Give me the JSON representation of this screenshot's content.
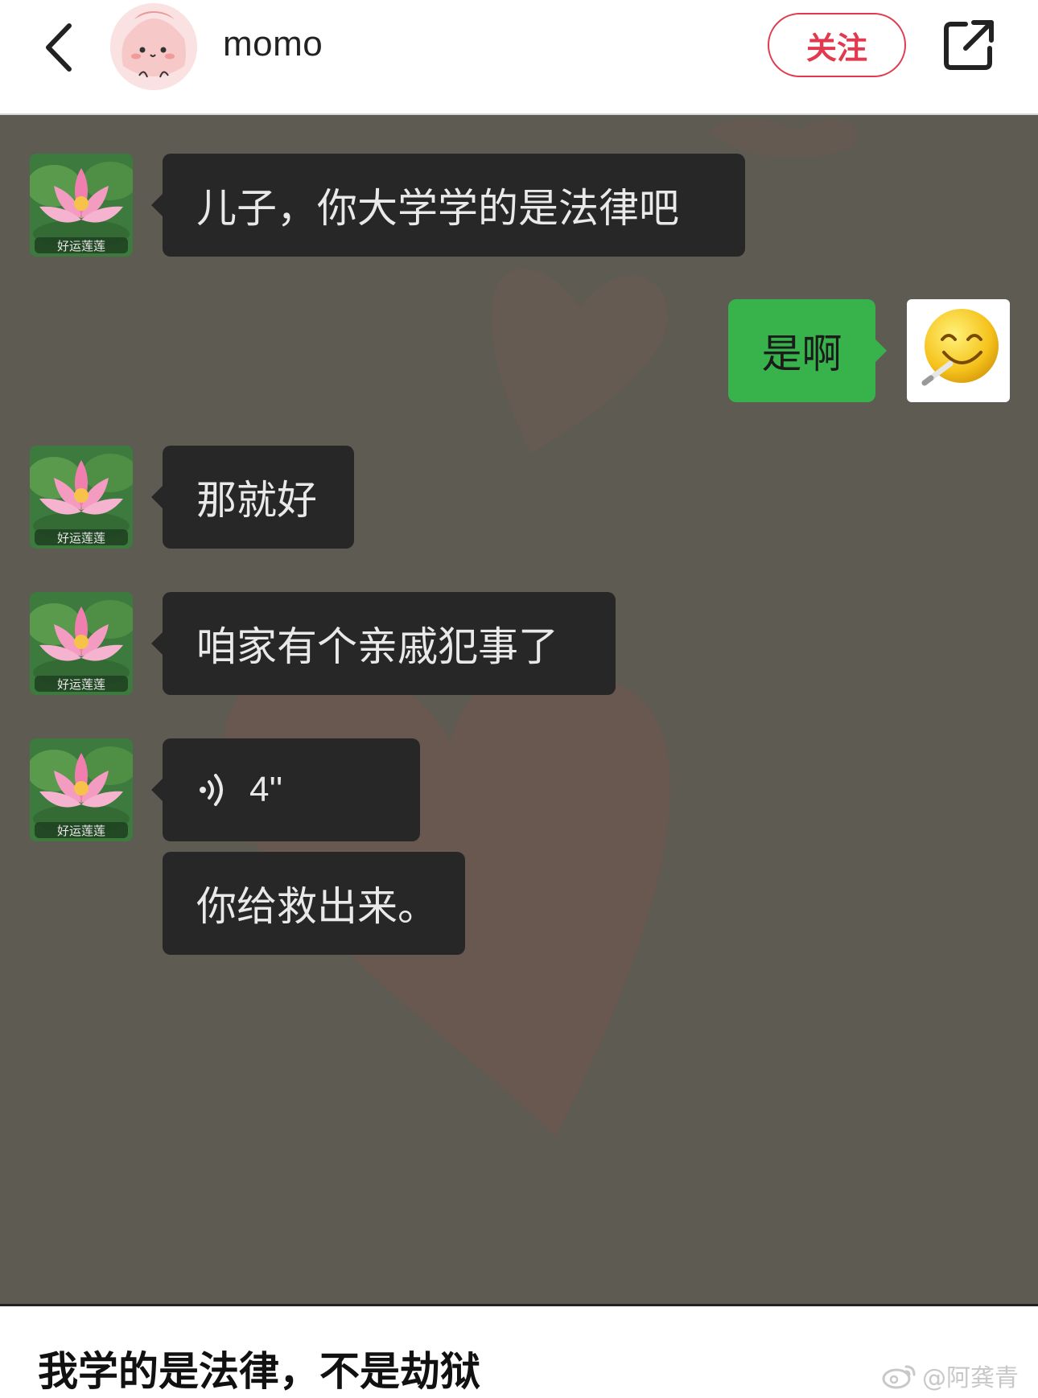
{
  "header": {
    "username": "momo",
    "follow_label": "关注",
    "back_icon": "chevron-left-icon",
    "share_icon": "share-external-icon",
    "follow_color": "#e2394f"
  },
  "chat": {
    "background_color": "#5e5b52",
    "sender_avatar": "lotus-avatar",
    "sender_avatar_text": "好运莲莲",
    "self_avatar": "smiling-emoji-avatar",
    "messages": [
      {
        "side": "left",
        "type": "text",
        "text": "儿子，你大学学的是法律吧"
      },
      {
        "side": "right",
        "type": "text",
        "text": "是啊"
      },
      {
        "side": "left",
        "type": "text",
        "text": "那就好"
      },
      {
        "side": "left",
        "type": "text",
        "text": "咱家有个亲戚犯事了"
      },
      {
        "side": "left",
        "type": "voice",
        "duration": "4''"
      },
      {
        "side": "left",
        "type": "text",
        "text": "你给救出来。"
      }
    ]
  },
  "caption": "我学的是法律，不是劫狱",
  "watermark": "@阿龚青"
}
